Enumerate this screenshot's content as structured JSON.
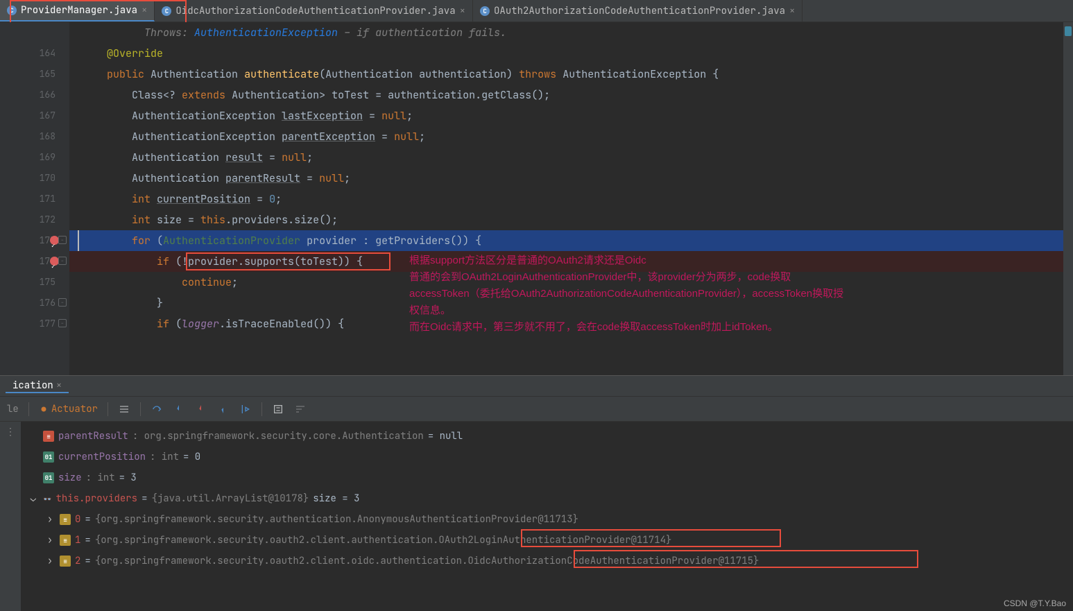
{
  "tabs": [
    {
      "name": "ProviderManager.java",
      "active": true
    },
    {
      "name": "OidcAuthorizationCodeAuthenticationProvider.java",
      "active": false
    },
    {
      "name": "OAuth2AuthorizationCodeAuthenticationProvider.java",
      "active": false
    }
  ],
  "doc_comment": {
    "label": "Throws:",
    "exception": "AuthenticationException",
    "desc": "– if authentication fails."
  },
  "code": {
    "l164": {
      "annotation": "@Override"
    },
    "l165": {
      "kw_public": "public",
      "type": "Authentication",
      "method": "authenticate",
      "param_type": "Authentication",
      "param_name": "authentication",
      "kw_throws": "throws",
      "exc": "AuthenticationException"
    },
    "l166": {
      "text_a": "Class<?",
      "kw_extends": "extends",
      "text_b": "Authentication> toTest = authentication.getClass();"
    },
    "l167": {
      "text_a": "AuthenticationException ",
      "var": "lastException",
      "text_b": " = ",
      "kw": "null",
      "text_c": ";"
    },
    "l168": {
      "text_a": "AuthenticationException ",
      "var": "parentException",
      "text_b": " = ",
      "kw": "null",
      "text_c": ";"
    },
    "l169": {
      "text_a": "Authentication ",
      "var": "result",
      "text_b": " = ",
      "kw": "null",
      "text_c": ";"
    },
    "l170": {
      "text_a": "Authentication ",
      "var": "parentResult",
      "text_b": " = ",
      "kw": "null",
      "text_c": ";"
    },
    "l171": {
      "kw_int": "int",
      "var": "currentPosition",
      "eq": " = ",
      "num": "0",
      "semi": ";"
    },
    "l172": {
      "kw_int": "int",
      "text_a": " size = ",
      "kw_this": "this",
      "text_b": ".providers.size();"
    },
    "l173": {
      "kw_for": "for",
      "text_a": " (",
      "type": "AuthenticationProvider",
      "text_b": " provider : getProviders()) {"
    },
    "l174": {
      "kw_if": "if",
      "text_a": " (!provider.supports(toTest)) {"
    },
    "l175": {
      "kw": "continue",
      "semi": ";"
    },
    "l176": {
      "brace": "}"
    },
    "l177": {
      "kw_if": "if",
      "text_a": " (",
      "ital": "logger",
      "text_b": ".isTraceEnabled()) {"
    }
  },
  "line_numbers": [
    "",
    "164",
    "165",
    "166",
    "167",
    "168",
    "169",
    "170",
    "171",
    "172",
    "173",
    "174",
    "175",
    "176",
    "177",
    ""
  ],
  "annotation": {
    "line1": "根据support方法区分是普通的OAuth2请求还是Oidc",
    "line2": "普通的会到OAuth2LoginAuthenticationProvider中，该provider分为两步，code换取",
    "line3": "accessToken（委托给OAuth2AuthorizationCodeAuthenticationProvider），accessToken换取授",
    "line4": "权信息。",
    "line5": "而在Oidc请求中，第三步就不用了，会在code换取accessToken时加上idToken。"
  },
  "debug": {
    "tab_label": "ication",
    "toolbar_label": "le",
    "actuator": "Actuator",
    "vars": {
      "parentResult": {
        "name": "parentResult",
        "type": ": org.springframework.security.core.Authentication ",
        "val": " = null"
      },
      "currentPosition": {
        "name": "currentPosition",
        "type": ": int ",
        "val": " = 0"
      },
      "size": {
        "name": "size",
        "type": ": int ",
        "val": " = 3"
      },
      "providers": {
        "name": "this.providers",
        "eq": " = ",
        "val": "{java.util.ArrayList@10178} ",
        "size": " size = 3"
      },
      "p0": {
        "idx": "0",
        "eq": " = ",
        "val": "{org.springframework.security.authentication.AnonymousAuthenticationProvider@11713}"
      },
      "p1": {
        "idx": "1",
        "eq": " = ",
        "val": "{org.springframework.security.oauth2.client.authentication.OAuth2LoginAuthenticationProvider@11714}"
      },
      "p2": {
        "idx": "2",
        "eq": " = ",
        "val": "{org.springframework.security.oauth2.client.oidc.authentication.OidcAuthorizationCodeAuthenticationProvider@11715}"
      }
    }
  },
  "watermark": "CSDN @T.Y.Bao"
}
